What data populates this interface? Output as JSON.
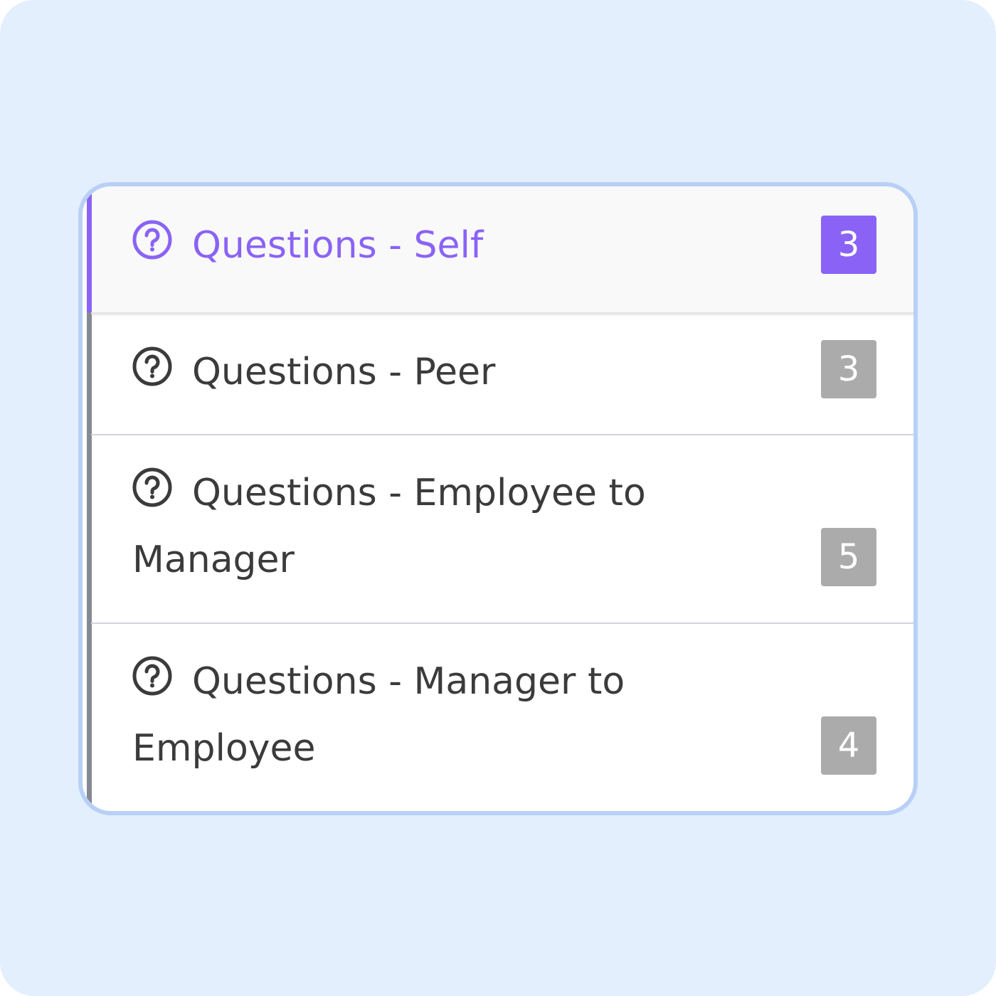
{
  "accent_color": "#8a63f6",
  "badge_inactive_color": "#ababab",
  "menu": {
    "items": [
      {
        "label": "Questions - Self",
        "count": "3",
        "active": true,
        "icon": "question-circle-icon"
      },
      {
        "label": "Questions - Peer",
        "count": "3",
        "active": false,
        "icon": "question-circle-icon"
      },
      {
        "label": "Questions - Employee to Manager",
        "count": "5",
        "active": false,
        "icon": "question-circle-icon"
      },
      {
        "label": "Questions - Manager to Employee",
        "count": "4",
        "active": false,
        "icon": "question-circle-icon"
      }
    ]
  }
}
